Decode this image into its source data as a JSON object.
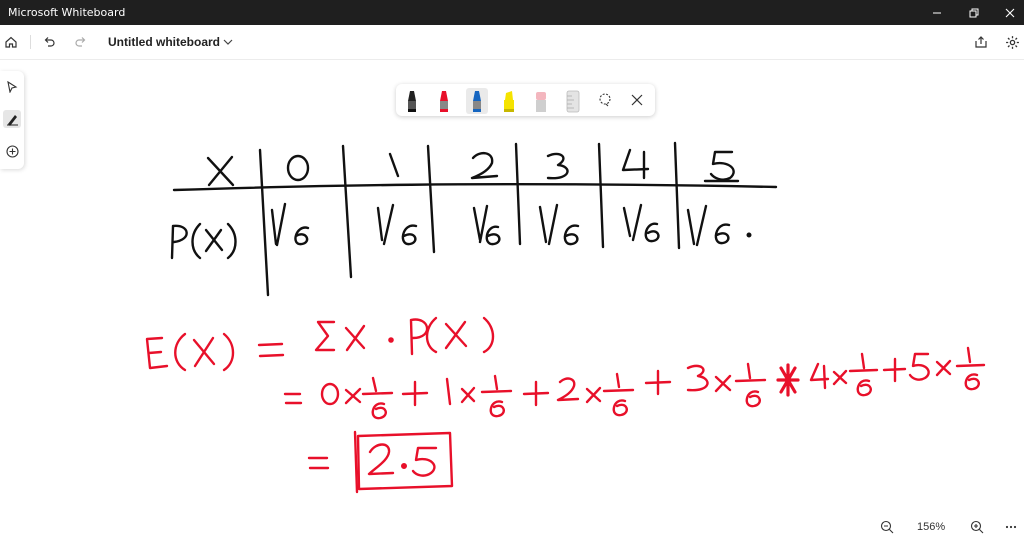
{
  "window": {
    "title": "Microsoft Whiteboard"
  },
  "toolbar": {
    "doc_name": "Untitled whiteboard"
  },
  "zoom": {
    "level": "156%"
  },
  "colors": {
    "ink_black": "#111111",
    "ink_red": "#e8102a",
    "titlebar": "#1f1f1f"
  },
  "icons": {
    "titlebar": [
      "minimize-icon",
      "restore-icon",
      "close-icon"
    ],
    "toolbar": [
      "home-icon",
      "undo-icon",
      "redo-icon",
      "chevron-down-icon",
      "share-icon",
      "settings-icon"
    ],
    "left_tools": [
      "select-icon",
      "ink-icon",
      "add-icon"
    ],
    "pen_tray": [
      "black-pen",
      "red-pen",
      "blue-pen",
      "yellow-highlighter",
      "eraser",
      "ruler",
      "lasso-icon",
      "close-icon"
    ],
    "zoom": [
      "zoom-out-icon",
      "zoom-in-icon",
      "more-icon"
    ]
  },
  "board": {
    "table": {
      "row1_label": "X",
      "row2_label": "P(x)",
      "x_values": [
        "0",
        "1",
        "2",
        "3",
        "4",
        "5"
      ],
      "p_values": [
        "1/6",
        "1/6",
        "1/6",
        "1/6",
        "1/6",
        "1/6."
      ]
    },
    "equation": {
      "line1": "E(X) = ΣX·P(X)",
      "line2": "= 0×1/6 + 1×1/6 + 2×1/6 + 3×1/6 + 4×1/6 + 5×1/6",
      "result": "2.5",
      "line3_prefix": "="
    }
  }
}
